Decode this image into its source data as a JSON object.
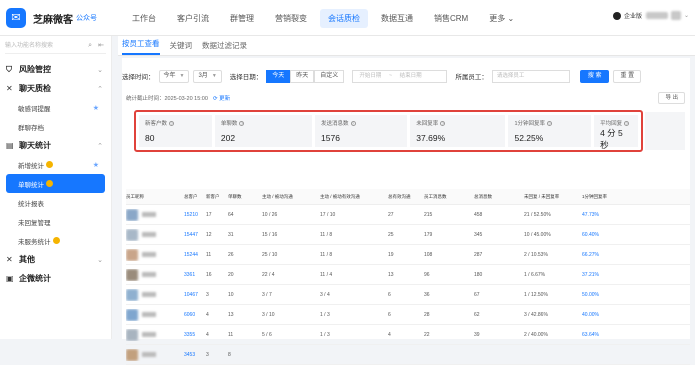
{
  "brand": {
    "name": "芝麻微客",
    "account_label": "公众号"
  },
  "nav": [
    "工作台",
    "客户引流",
    "群管理",
    "营销裂变",
    "会话质检",
    "数据互通",
    "销售CRM",
    "更多 ⌄"
  ],
  "nav_active_index": 4,
  "user": {
    "label": "企业版"
  },
  "sidebar": {
    "search_placeholder": "输入功能名称搜索",
    "groups": [
      {
        "label": "风险管控",
        "icon": "shield-icon"
      },
      {
        "label": "聊天质检",
        "icon": "inspect-icon",
        "items": [
          {
            "label": "敏感词提醒",
            "starred": true
          },
          {
            "label": "群聊存档"
          }
        ]
      },
      {
        "label": "聊天统计",
        "icon": "chart-icon",
        "items": [
          {
            "label": "新增统计",
            "starred": true,
            "badge": true
          },
          {
            "label": "单聊统计",
            "active": true,
            "badge": true
          },
          {
            "label": "统计报表"
          },
          {
            "label": "未回复管理"
          },
          {
            "label": "未服务统计",
            "badge": true
          }
        ]
      },
      {
        "label": "其他",
        "icon": "tool-icon"
      },
      {
        "label": "企微统计",
        "icon": "stats-icon"
      }
    ]
  },
  "tabs": [
    "按员工查看",
    "关键词",
    "数据过滤记录"
  ],
  "filters": {
    "time_label": "选择时间：",
    "year": "今年",
    "month": "3月",
    "date_label": "选择日期：",
    "date_buttons": [
      "今天",
      "昨天",
      "自定义"
    ],
    "date_active": 0,
    "start_placeholder": "开始日期",
    "range_sep": "~",
    "end_placeholder": "结束日期",
    "employee_label": "所属员工：",
    "employee_placeholder": "请选择员工",
    "search_label": "搜 索",
    "reset_label": "重 置"
  },
  "meta": {
    "deadline": "统计截止时间：2025-03-20 15:00",
    "refresh": "更新"
  },
  "export_label": "导 出",
  "stats": [
    {
      "label": "新客户数",
      "value": "80"
    },
    {
      "label": "单聊数",
      "value": "202"
    },
    {
      "label": "发送消息数",
      "value": "1576"
    },
    {
      "label": "未回复率",
      "value": "37.69%"
    },
    {
      "label": "1分钟回复率",
      "value": "52.25%"
    },
    {
      "label": "平均回复",
      "value": "4 分 5 秒"
    }
  ],
  "table": {
    "columns": [
      "员工昵称",
      "总客户",
      "新客户",
      "单聊数",
      "主动 / 被动沟通",
      "主动 / 被动有效沟通",
      "总有效沟通",
      "员工消息数",
      "总消息数",
      "未回复 / 未回复率",
      "1分钟回复率"
    ],
    "rows": [
      [
        "15210",
        "17",
        "64",
        "10 / 26",
        "17 / 10",
        "27",
        "215",
        "458",
        "21 / 52.50%",
        "47.73%"
      ],
      [
        "15447",
        "12",
        "31",
        "15 / 16",
        "11 / 8",
        "25",
        "179",
        "345",
        "10 / 45.00%",
        "60.40%"
      ],
      [
        "15244",
        "11",
        "26",
        "25 / 10",
        "11 / 8",
        "19",
        "108",
        "287",
        "2 / 10.53%",
        "66.27%"
      ],
      [
        "3361",
        "16",
        "20",
        "22 / 4",
        "11 / 4",
        "13",
        "96",
        "180",
        "1 / 6.67%",
        "37.21%"
      ],
      [
        "10467",
        "3",
        "10",
        "3 / 7",
        "3 / 4",
        "6",
        "36",
        "67",
        "1 / 12.50%",
        "50.00%"
      ],
      [
        "6060",
        "4",
        "13",
        "3 / 10",
        "1 / 3",
        "6",
        "28",
        "62",
        "3 / 42.86%",
        "40.00%"
      ],
      [
        "3355",
        "4",
        "11",
        "5 / 6",
        "1 / 3",
        "4",
        "22",
        "39",
        "2 / 40.00%",
        "63.64%"
      ],
      [
        "3453",
        "3",
        "8",
        "",
        "",
        "",
        "",
        "",
        "",
        ""
      ]
    ]
  }
}
